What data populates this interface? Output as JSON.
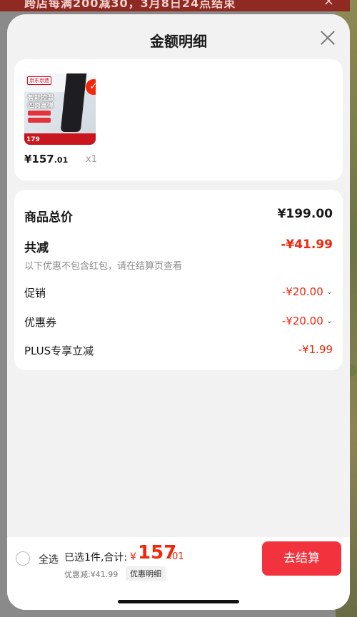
{
  "background": {
    "promo_text": "跨店每满200减30，3月8日24点结束",
    "promo_close": "×"
  },
  "sheet": {
    "title": "金额明细",
    "close_icon": "close-icon"
  },
  "product": {
    "thumb_logo": "京东京造",
    "thumb_line1": "智能控温",
    "thumb_line2": "四面高弹",
    "thumb_price": "179",
    "price_symbol": "¥",
    "price_int": "157",
    "price_cents": ".01",
    "quantity": "x1"
  },
  "detail": {
    "total_label": "商品总价",
    "total_value": "¥199.00",
    "reduce_label": "共减",
    "reduce_value": "-¥41.99",
    "note": "以下优惠不包含红包，请在结算页查看",
    "promo_label": "促销",
    "promo_value": "-¥20.00",
    "coupon_label": "优惠券",
    "coupon_value": "-¥20.00",
    "plus_label": "PLUS专享立减",
    "plus_value": "-¥1.99"
  },
  "bottom": {
    "select_all": "全选",
    "selected": "已选1件,合计:",
    "sum_symbol": "¥",
    "sum_int": "157",
    "sum_dec": ".01",
    "discount": "优惠减:¥41.99",
    "detail_link": "优惠明细",
    "checkout": "去结算"
  },
  "colors": {
    "accent": "#f2270c",
    "button": "#f2333e"
  }
}
